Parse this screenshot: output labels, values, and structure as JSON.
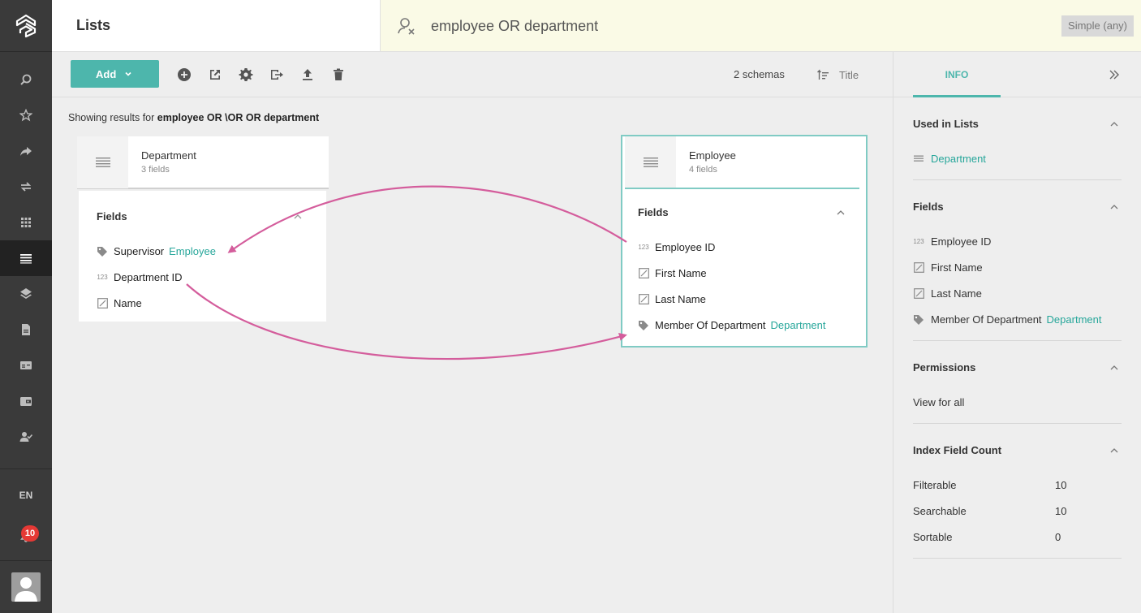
{
  "app": {
    "title": "Lists"
  },
  "search": {
    "query": "employee OR department",
    "mode": "Simple (any)"
  },
  "nav": {
    "items": [
      "search-icon",
      "star-icon",
      "share-icon",
      "swap-icon",
      "apps-icon",
      "lists-icon",
      "layers-icon",
      "document-icon",
      "card-icon",
      "wallet-icon",
      "user-check-icon"
    ],
    "active": "lists-icon",
    "language": "EN",
    "notifications": "10"
  },
  "toolbar": {
    "add_label": "Add",
    "schema_count": "2 schemas",
    "sort_label": "Title"
  },
  "results": {
    "prefix": "Showing results for",
    "query": "employee OR \\OR OR department"
  },
  "cards": [
    {
      "name": "Department",
      "count": "3 fields",
      "fields_title": "Fields",
      "fields": [
        {
          "icon": "tag-icon",
          "label": "Supervisor",
          "ref": "Employee"
        },
        {
          "icon": "number-icon",
          "label": "Department ID",
          "ref": ""
        },
        {
          "icon": "text-icon",
          "label": "Name",
          "ref": ""
        }
      ]
    },
    {
      "name": "Employee",
      "count": "4 fields",
      "fields_title": "Fields",
      "fields": [
        {
          "icon": "number-icon",
          "label": "Employee ID",
          "ref": ""
        },
        {
          "icon": "text-icon",
          "label": "First Name",
          "ref": ""
        },
        {
          "icon": "text-icon",
          "label": "Last Name",
          "ref": ""
        },
        {
          "icon": "tag-icon",
          "label": "Member Of Department",
          "ref": "Department"
        }
      ]
    }
  ],
  "panel": {
    "tab": "INFO",
    "used_in_lists": {
      "title": "Used in Lists",
      "items": [
        "Department"
      ]
    },
    "fields": {
      "title": "Fields",
      "items": [
        {
          "icon": "number-icon",
          "label": "Employee ID",
          "ref": ""
        },
        {
          "icon": "text-icon",
          "label": "First Name",
          "ref": ""
        },
        {
          "icon": "text-icon",
          "label": "Last Name",
          "ref": ""
        },
        {
          "icon": "tag-icon",
          "label": "Member Of Department",
          "ref": "Department"
        }
      ]
    },
    "permissions": {
      "title": "Permissions",
      "value": "View for all"
    },
    "index": {
      "title": "Index Field Count",
      "rows": [
        {
          "label": "Filterable",
          "value": "10"
        },
        {
          "label": "Searchable",
          "value": "10"
        },
        {
          "label": "Sortable",
          "value": "0"
        }
      ]
    }
  },
  "colors": {
    "accent": "#4db6ac",
    "link": "#26a69a",
    "arrow": "#d45d9c",
    "sidebar": "#3a3a3a"
  }
}
